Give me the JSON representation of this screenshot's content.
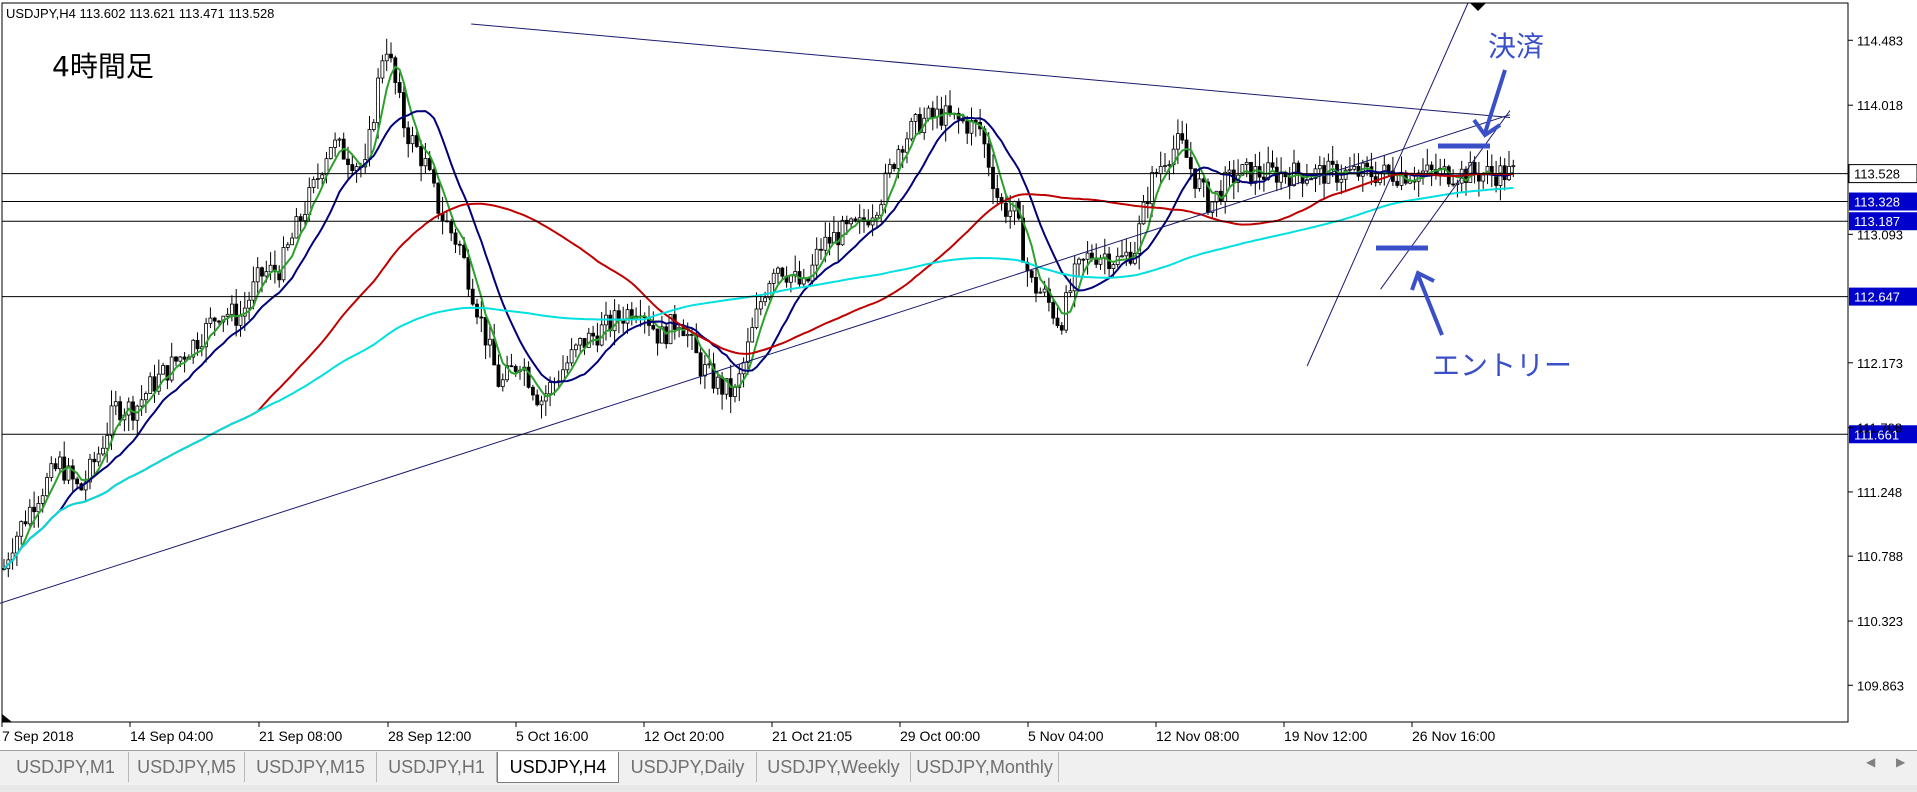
{
  "window": {
    "header": "USDJPY,H4  113.602 113.621 113.471 113.528"
  },
  "chart_data": {
    "type": "candlestick",
    "symbol": "USDJPY",
    "timeframe": "H4",
    "ohlc_last": {
      "open": 113.602,
      "high": 113.621,
      "low": 113.471,
      "close": 113.528
    },
    "ylim": [
      109.6,
      114.75
    ],
    "grid": false,
    "time_labels": [
      "7 Sep 2018",
      "14 Sep 04:00",
      "21 Sep 08:00",
      "28 Sep 12:00",
      "5 Oct 16:00",
      "12 Oct 20:00",
      "21 Oct 21:05",
      "29 Oct 00:00",
      "5 Nov 04:00",
      "12 Nov 08:00",
      "19 Nov 12:00",
      "26 Nov 16:00"
    ],
    "price_ticks": [
      "114.483",
      "114.018",
      "113.093",
      "112.173",
      "111.708",
      "111.248",
      "110.788",
      "110.323",
      "109.863"
    ],
    "horizontal_levels": [
      {
        "label": "113.528",
        "value": 113.528,
        "style": "current"
      },
      {
        "label": "113.328",
        "value": 113.328,
        "style": "level"
      },
      {
        "label": "113.187",
        "value": 113.187,
        "style": "level"
      },
      {
        "label": "112.647",
        "value": 112.647,
        "style": "level"
      },
      {
        "label": "111.661",
        "value": 111.661,
        "style": "level"
      }
    ],
    "price_anchors": [
      [
        0,
        110.6
      ],
      [
        10,
        110.85
      ],
      [
        35,
        111.2
      ],
      [
        60,
        111.45
      ],
      [
        80,
        111.25
      ],
      [
        100,
        111.55
      ],
      [
        115,
        111.85
      ],
      [
        135,
        111.85
      ],
      [
        150,
        112.0
      ],
      [
        185,
        112.25
      ],
      [
        205,
        112.4
      ],
      [
        220,
        112.55
      ],
      [
        240,
        112.5
      ],
      [
        260,
        112.8
      ],
      [
        280,
        112.85
      ],
      [
        300,
        113.2
      ],
      [
        315,
        113.45
      ],
      [
        330,
        113.75
      ],
      [
        350,
        113.65
      ],
      [
        365,
        113.55
      ],
      [
        385,
        114.5
      ],
      [
        405,
        113.85
      ],
      [
        425,
        113.6
      ],
      [
        440,
        113.25
      ],
      [
        460,
        113.0
      ],
      [
        480,
        112.5
      ],
      [
        500,
        112.0
      ],
      [
        520,
        112.2
      ],
      [
        540,
        111.9
      ],
      [
        560,
        112.1
      ],
      [
        580,
        112.3
      ],
      [
        600,
        112.4
      ],
      [
        620,
        112.5
      ],
      [
        640,
        112.6
      ],
      [
        660,
        112.35
      ],
      [
        680,
        112.5
      ],
      [
        700,
        112.15
      ],
      [
        720,
        112.0
      ],
      [
        735,
        111.95
      ],
      [
        745,
        112.2
      ],
      [
        760,
        112.6
      ],
      [
        775,
        112.9
      ],
      [
        790,
        112.8
      ],
      [
        805,
        112.7
      ],
      [
        820,
        113.0
      ],
      [
        840,
        113.1
      ],
      [
        860,
        113.15
      ],
      [
        880,
        113.35
      ],
      [
        900,
        113.75
      ],
      [
        920,
        113.9
      ],
      [
        940,
        113.95
      ],
      [
        960,
        113.9
      ],
      [
        980,
        113.85
      ],
      [
        1000,
        113.3
      ],
      [
        1015,
        113.25
      ],
      [
        1030,
        112.75
      ],
      [
        1045,
        112.65
      ],
      [
        1060,
        112.45
      ],
      [
        1075,
        112.8
      ],
      [
        1090,
        112.95
      ],
      [
        1105,
        112.95
      ],
      [
        1120,
        112.9
      ],
      [
        1135,
        113.0
      ],
      [
        1150,
        113.45
      ],
      [
        1165,
        113.65
      ],
      [
        1180,
        113.75
      ],
      [
        1195,
        113.5
      ],
      [
        1210,
        113.3
      ],
      [
        1225,
        113.45
      ],
      [
        1237,
        113.53
      ]
    ],
    "series": [
      {
        "type": "line",
        "color": "#2ca02c"
      },
      {
        "type": "line",
        "color": "#00007a"
      },
      {
        "type": "line",
        "color": "#c00000"
      },
      {
        "type": "line",
        "color": "#00e0e0"
      }
    ],
    "trendlines": [
      {
        "from": [
          385,
          114.6
        ],
        "to": [
          1510,
          113.93
        ]
      },
      {
        "from": [
          0,
          110.45
        ],
        "to": [
          1510,
          113.95
        ]
      },
      {
        "from": [
          1068,
          112.15
        ],
        "to": [
          1468,
          114.75
        ]
      },
      {
        "from": [
          1128,
          112.7
        ],
        "to": [
          1510,
          113.98
        ]
      }
    ],
    "annotations": [
      {
        "text": "4時間足",
        "style": "title"
      },
      {
        "text": "決済",
        "style": "note"
      },
      {
        "text": "エントリー",
        "style": "note"
      }
    ]
  },
  "tabs": [
    {
      "label": "USDJPY,M1"
    },
    {
      "label": "USDJPY,M5"
    },
    {
      "label": "USDJPY,M15"
    },
    {
      "label": "USDJPY,H1"
    },
    {
      "label": "USDJPY,H4",
      "active": true
    },
    {
      "label": "USDJPY,Daily"
    },
    {
      "label": "USDJPY,Weekly"
    },
    {
      "label": "USDJPY,Monthly"
    }
  ],
  "colors": {
    "annotation": "#3a4fc8",
    "axis": "#000000",
    "label_bg": "#0000cc",
    "current_bg": "#000000"
  }
}
